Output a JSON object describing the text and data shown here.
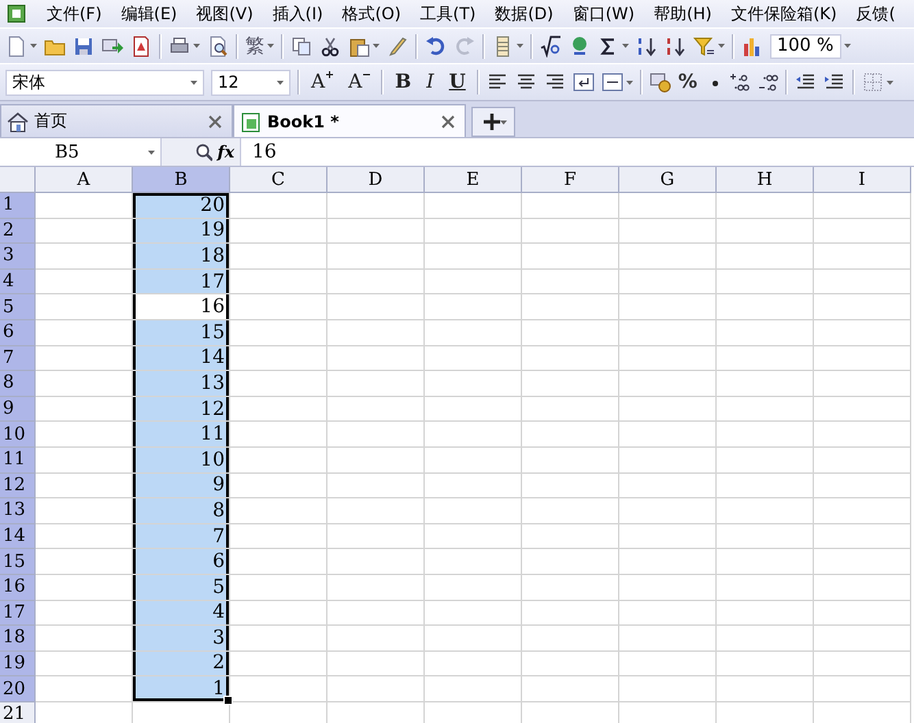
{
  "menu_bar": {
    "items": [
      "文件(F)",
      "编辑(E)",
      "视图(V)",
      "插入(I)",
      "格式(O)",
      "工具(T)",
      "数据(D)",
      "窗口(W)",
      "帮助(H)",
      "文件保险箱(K)",
      "反馈("
    ]
  },
  "standard_toolbar": {
    "traditional_label": "繁",
    "zoom": "100 %"
  },
  "format_toolbar": {
    "font": "宋体",
    "font_size": "12",
    "text_buttons": [
      {
        "label": "A",
        "kind": "grow"
      },
      {
        "label": "A",
        "kind": "shrink"
      },
      {
        "label": "B",
        "kind": "bold"
      },
      {
        "label": "I",
        "kind": "italic"
      },
      {
        "label": "U",
        "kind": "underline"
      }
    ],
    "percent_label": "%"
  },
  "tabs": [
    {
      "label": "首页",
      "selected": false,
      "kind": "home"
    },
    {
      "label": "Book1 *",
      "selected": true,
      "kind": "workbook"
    }
  ],
  "formula_bar": {
    "name_box": "B5",
    "function_label": "fx",
    "value": "16"
  },
  "sheet": {
    "columns": [
      {
        "label": "A",
        "selected": false
      },
      {
        "label": "B",
        "selected": true,
        "cells": [
          {
            "text": "20",
            "selected": true,
            "active": false
          },
          {
            "text": "19",
            "selected": true,
            "active": false
          },
          {
            "text": "18",
            "selected": true,
            "active": false
          },
          {
            "text": "17",
            "selected": true,
            "active": false
          },
          {
            "text": "16",
            "selected": true,
            "active": true
          },
          {
            "text": "15",
            "selected": true,
            "active": false
          },
          {
            "text": "14",
            "selected": true,
            "active": false
          },
          {
            "text": "13",
            "selected": true,
            "active": false
          },
          {
            "text": "12",
            "selected": true,
            "active": false
          },
          {
            "text": "11",
            "selected": true,
            "active": false
          },
          {
            "text": "10",
            "selected": true,
            "active": false
          },
          {
            "text": "9",
            "selected": true,
            "active": false
          },
          {
            "text": "8",
            "selected": true,
            "active": false
          },
          {
            "text": "7",
            "selected": true,
            "active": false
          },
          {
            "text": "6",
            "selected": true,
            "active": false
          },
          {
            "text": "5",
            "selected": true,
            "active": false
          },
          {
            "text": "4",
            "selected": true,
            "active": false
          },
          {
            "text": "3",
            "selected": true,
            "active": false
          },
          {
            "text": "2",
            "selected": true,
            "active": false
          },
          {
            "text": "1",
            "selected": true,
            "active": false
          }
        ]
      },
      {
        "label": "C",
        "selected": false
      },
      {
        "label": "D",
        "selected": false
      },
      {
        "label": "E",
        "selected": false
      },
      {
        "label": "F",
        "selected": false
      },
      {
        "label": "G",
        "selected": false
      },
      {
        "label": "H",
        "selected": false
      },
      {
        "label": "I",
        "selected": false
      }
    ],
    "rows": [
      {
        "label": "1",
        "selected": true
      },
      {
        "label": "2",
        "selected": true
      },
      {
        "label": "3",
        "selected": true
      },
      {
        "label": "4",
        "selected": true
      },
      {
        "label": "5",
        "selected": true
      },
      {
        "label": "6",
        "selected": true
      },
      {
        "label": "7",
        "selected": true
      },
      {
        "label": "8",
        "selected": true
      },
      {
        "label": "9",
        "selected": true
      },
      {
        "label": "10",
        "selected": true
      },
      {
        "label": "11",
        "selected": true
      },
      {
        "label": "12",
        "selected": true
      },
      {
        "label": "13",
        "selected": true
      },
      {
        "label": "14",
        "selected": true
      },
      {
        "label": "15",
        "selected": true
      },
      {
        "label": "16",
        "selected": true
      },
      {
        "label": "17",
        "selected": true
      },
      {
        "label": "18",
        "selected": true
      },
      {
        "label": "19",
        "selected": true
      },
      {
        "label": "20",
        "selected": true
      },
      {
        "label": "21",
        "selected": false
      }
    ]
  }
}
